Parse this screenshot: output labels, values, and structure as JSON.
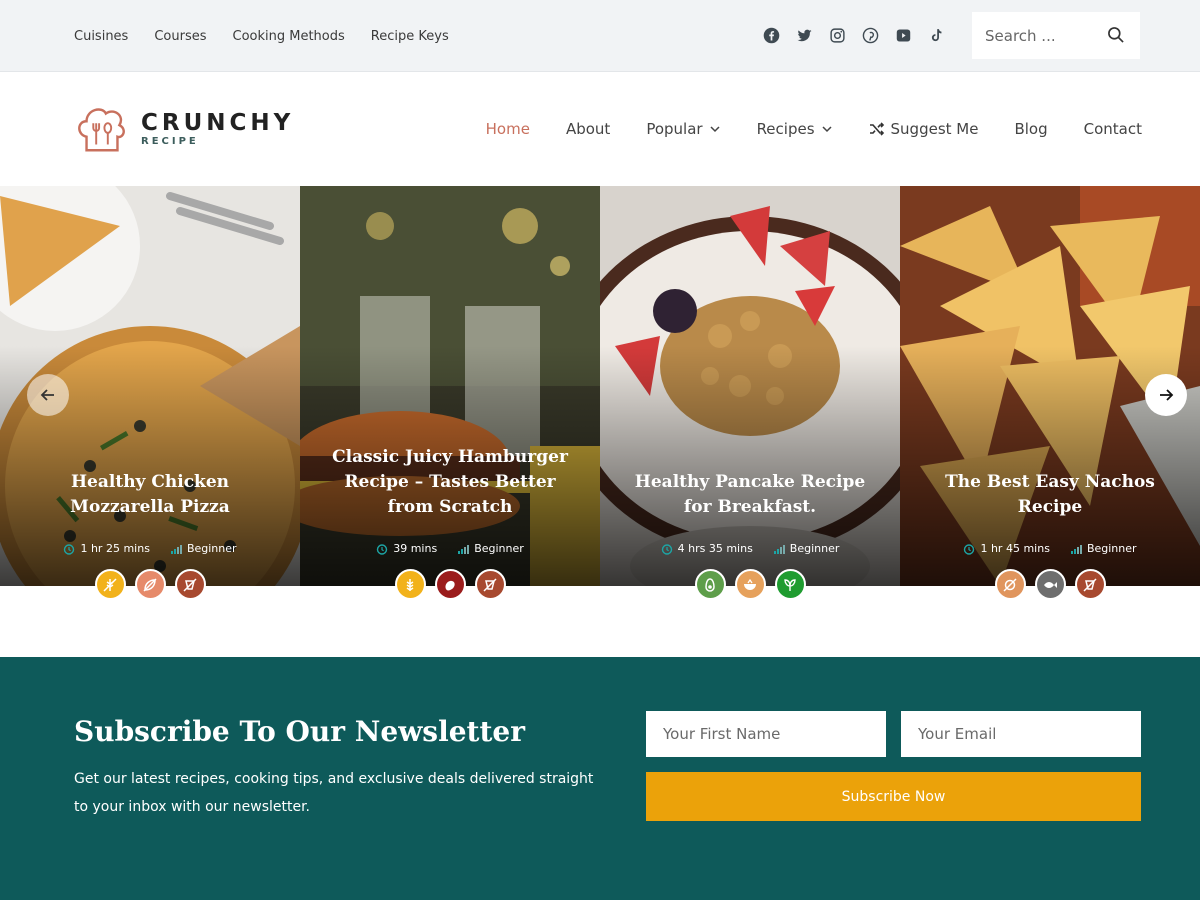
{
  "topbar": {
    "links": [
      "Cuisines",
      "Courses",
      "Cooking Methods",
      "Recipe Keys"
    ],
    "social_icons": [
      "facebook-icon",
      "twitter-icon",
      "instagram-icon",
      "pinterest-icon",
      "youtube-icon",
      "tiktok-icon"
    ],
    "search_placeholder": "Search ..."
  },
  "header": {
    "logo_title": "CRUNCHY",
    "logo_subtitle": "RECIPE",
    "nav": [
      {
        "label": "Home",
        "active": true
      },
      {
        "label": "About"
      },
      {
        "label": "Popular",
        "dropdown": true
      },
      {
        "label": "Recipes",
        "dropdown": true
      },
      {
        "label": "Suggest Me",
        "icon": "shuffle-icon"
      },
      {
        "label": "Blog"
      },
      {
        "label": "Contact"
      }
    ]
  },
  "slider": {
    "cards": [
      {
        "title": "Healthy Chicken Mozzarella Pizza",
        "time": "1 hr 25 mins",
        "level": "Beginner",
        "badges": [
          {
            "icon": "wheat-free-icon",
            "color": "#f2b21b"
          },
          {
            "icon": "no-leaf-icon",
            "color": "#e68a6a"
          },
          {
            "icon": "no-meat-icon",
            "color": "#a7492f"
          }
        ]
      },
      {
        "title": "Classic Juicy Hamburger Recipe – Tastes Better from Scratch",
        "time": "39 mins",
        "level": "Beginner",
        "badges": [
          {
            "icon": "grain-icon",
            "color": "#f2b21b"
          },
          {
            "icon": "meat-icon",
            "color": "#9b1c1c"
          },
          {
            "icon": "no-meat-icon",
            "color": "#a7492f"
          }
        ]
      },
      {
        "title": "Healthy Pancake Recipe for Breakfast.",
        "time": "4 hrs 35 mins",
        "level": "Beginner",
        "badges": [
          {
            "icon": "avocado-icon",
            "color": "#5e9e4a"
          },
          {
            "icon": "bowl-icon",
            "color": "#e6a15c"
          },
          {
            "icon": "vegan-icon",
            "color": "#1f9c30"
          }
        ]
      },
      {
        "title": "The Best Easy Nachos Recipe",
        "time": "1 hr 45 mins",
        "level": "Beginner",
        "badges": [
          {
            "icon": "no-nut-icon",
            "color": "#e0955d"
          },
          {
            "icon": "fish-icon",
            "color": "#6e6e6e"
          },
          {
            "icon": "no-meat-icon",
            "color": "#a7492f"
          }
        ]
      }
    ]
  },
  "newsletter": {
    "title": "Subscribe To Our Newsletter",
    "text": "Get our latest recipes, cooking tips, and exclusive deals delivered straight to your inbox with our newsletter.",
    "first_name_placeholder": "Your First Name",
    "email_placeholder": "Your Email",
    "button": "Subscribe Now"
  },
  "colors": {
    "accent": "#c8705d",
    "newsletter_bg": "#0e5a5a",
    "button": "#eba20a"
  }
}
